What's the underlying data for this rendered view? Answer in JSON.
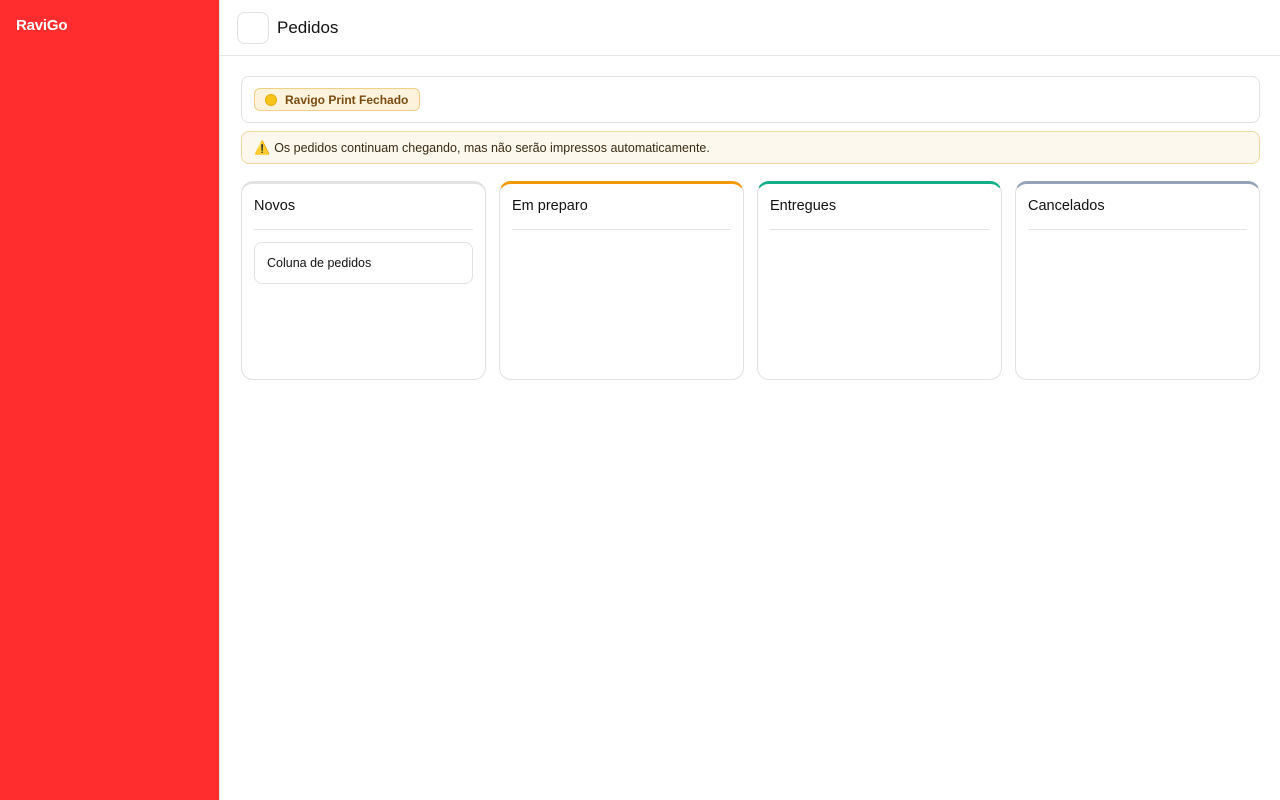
{
  "sidebar": {
    "brand": "RaviGo",
    "brand_color": "#ff2d2d"
  },
  "header": {
    "title": "Pedidos"
  },
  "status": {
    "badge_label": "Ravigo Print Fechado",
    "state": "closed"
  },
  "warning": {
    "icon": "⚠️",
    "message": "Os pedidos continuam chegando, mas não serão impressos automaticamente."
  },
  "columns": [
    {
      "title": "Novos",
      "accent": "#e3e3e3",
      "cards": [
        {
          "label": "Coluna de pedidos"
        }
      ]
    },
    {
      "title": "Em preparo",
      "accent": "#f29a0a",
      "cards": []
    },
    {
      "title": "Entregues",
      "accent": "#14b08a",
      "cards": []
    },
    {
      "title": "Cancelados",
      "accent": "#94a3b8",
      "cards": []
    }
  ]
}
